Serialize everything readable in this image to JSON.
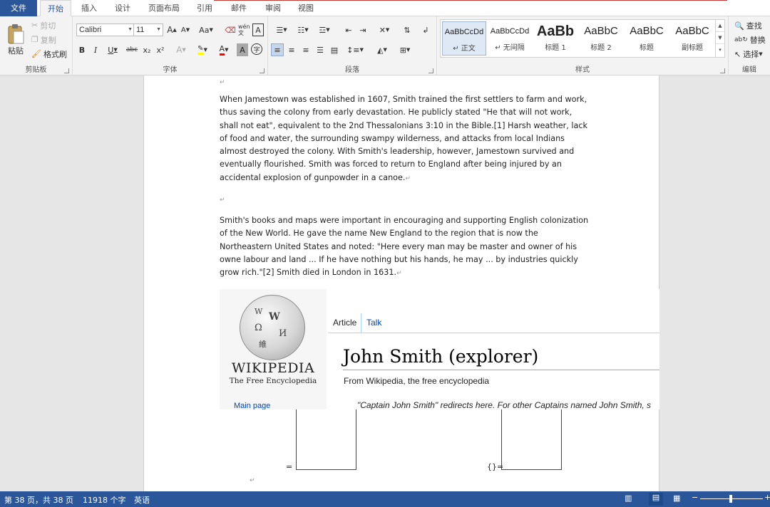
{
  "menu": {
    "file": "文件",
    "tabs": [
      "开始",
      "插入",
      "设计",
      "页面布局",
      "引用",
      "邮件",
      "审阅",
      "视图"
    ]
  },
  "ribbon": {
    "clipboard": {
      "paste": "粘贴",
      "cut": "剪切",
      "copy": "复制",
      "format_painter": "格式刷",
      "label": "剪贴板"
    },
    "font": {
      "name": "Calibri",
      "size": "11",
      "label": "字体",
      "bold": "B",
      "italic": "I",
      "underline": "U",
      "strike": "abc",
      "sub": "x₂",
      "sup": "x²",
      "grow": "A",
      "shrink": "A",
      "case": "Aa",
      "phonetic": "wén 文",
      "border_char": "A",
      "color_a": "A",
      "shade_a": "A",
      "circle": "字"
    },
    "paragraph": {
      "label": "段落"
    },
    "styles": {
      "label": "样式",
      "items": [
        {
          "sample": "AaBbCcDd",
          "name": "↵ 正文"
        },
        {
          "sample": "AaBbCcDd",
          "name": "↵ 无间隔"
        },
        {
          "sample": "AaBb",
          "name": "标题 1"
        },
        {
          "sample": "AaBbC",
          "name": "标题 2"
        },
        {
          "sample": "AaBbC",
          "name": "标题"
        },
        {
          "sample": "AaBbC",
          "name": "副标题"
        }
      ]
    },
    "editing": {
      "find": "查找",
      "replace": "替换",
      "select": "选择",
      "label": "编辑"
    }
  },
  "document": {
    "para1": "When Jamestown was established in 1607, Smith trained the first settlers to farm and work, thus saving the colony from early devastation. He publicly stated \"He that will not work, shall not eat\", equivalent to the 2nd Thessalonians 3:10 in the Bible.[1] Harsh weather, lack of food and water, the surrounding swampy wilderness, and attacks from local Indians almost destroyed the colony. With Smith's leadership, however, Jamestown survived and eventually flourished. Smith was forced to return to England after being injured by an accidental explosion of gunpowder in a canoe.",
    "para2": "Smith's books and maps were important in encouraging and supporting English colonization of the New World. He gave the name New England to the region that is now the Northeastern United States and noted: \"Here every man may be master and owner of his owne labour and land ... If he have nothing but his hands, he may ... by industries quickly grow rich.\"[2] Smith died in London in 1631.",
    "pilcrow": "↵",
    "wiki": {
      "logo_title": "WIKIPEDIA",
      "logo_sub": "The Free Encyclopedia",
      "nav_main": "Main page",
      "tab_article": "Article",
      "tab_talk": "Talk",
      "title": "John Smith (explorer)",
      "from": "From Wikipedia, the free encyclopedia",
      "hatnote": "\"Captain John Smith\" redirects here. For other Captains named John Smith, s",
      "globe_glyphs": [
        "W",
        "Ω",
        "И",
        "維"
      ]
    },
    "field_left": "=",
    "field_right": "{}="
  },
  "status": {
    "page": "第 38 页，共 38 页",
    "words": "11918 个字",
    "lang": "英语"
  },
  "colors": {
    "accent": "#2b579a",
    "highlight": "#ffff00",
    "font_color": "#ff0000"
  }
}
